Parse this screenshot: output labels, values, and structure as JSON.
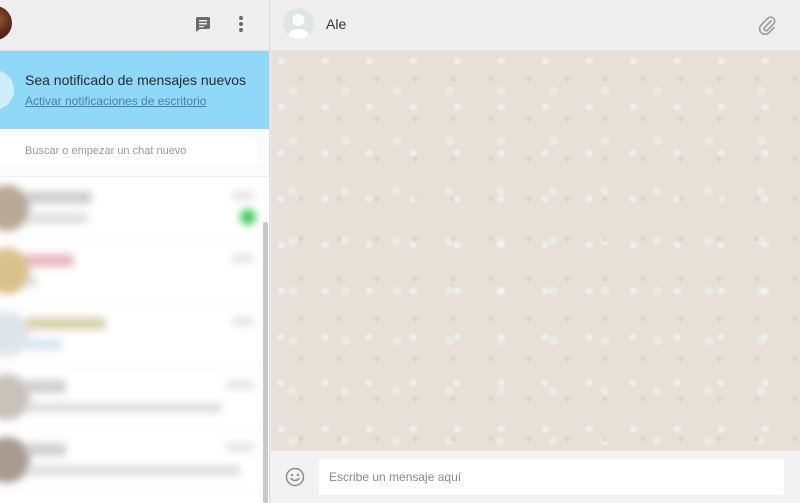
{
  "sidebar": {
    "header": {
      "new_chat_icon": "chat-icon",
      "menu_icon": "more-vertical-icon"
    },
    "notification": {
      "title": "Sea notificado de mensajes nuevos",
      "link": "Activar notificaciones de escritorio"
    },
    "search": {
      "placeholder": "Buscar o empezar un chat nuevo"
    },
    "chats_blurred": true
  },
  "chat": {
    "contact_name": "Ale",
    "attach_icon": "paperclip-icon",
    "composer": {
      "placeholder": "Escribe un mensaje aquí",
      "emoji_icon": "smiley-icon"
    }
  },
  "colors": {
    "notification_bg": "#8fd8f8",
    "header_bg": "#eeeeee",
    "wallpaper": "#e6e0d8",
    "unread_badge": "#3ecf5a"
  }
}
